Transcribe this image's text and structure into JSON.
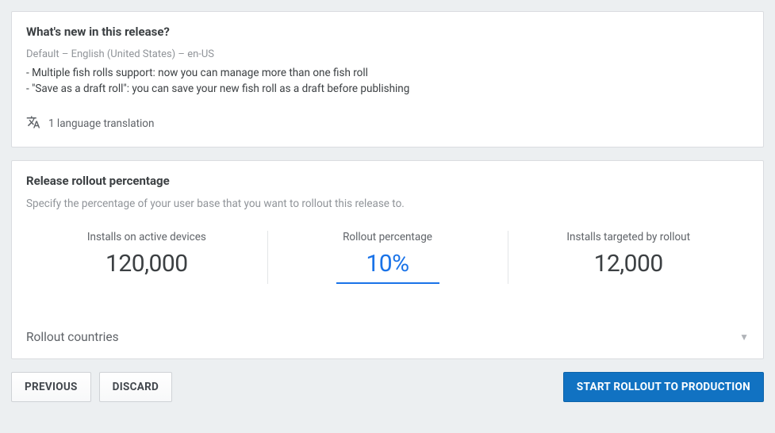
{
  "release_notes": {
    "title": "What's new in this release?",
    "locale_line": "Default – English (United States) – en-US",
    "bullets": [
      "- Multiple fish rolls support: now you can manage more than one fish roll",
      "- \"Save as a draft roll\": you can save your new fish roll as a draft before publishing"
    ],
    "translation_text": "1 language translation"
  },
  "rollout": {
    "title": "Release rollout percentage",
    "description": "Specify the percentage of your user base that you want to rollout this release to.",
    "stats": {
      "installs_label": "Installs on active devices",
      "installs_value": "120,000",
      "percentage_label": "Rollout percentage",
      "percentage_value": "10%",
      "targeted_label": "Installs targeted by rollout",
      "targeted_value": "12,000"
    },
    "countries_label": "Rollout countries"
  },
  "actions": {
    "previous": "PREVIOUS",
    "discard": "DISCARD",
    "start": "START ROLLOUT TO PRODUCTION"
  }
}
